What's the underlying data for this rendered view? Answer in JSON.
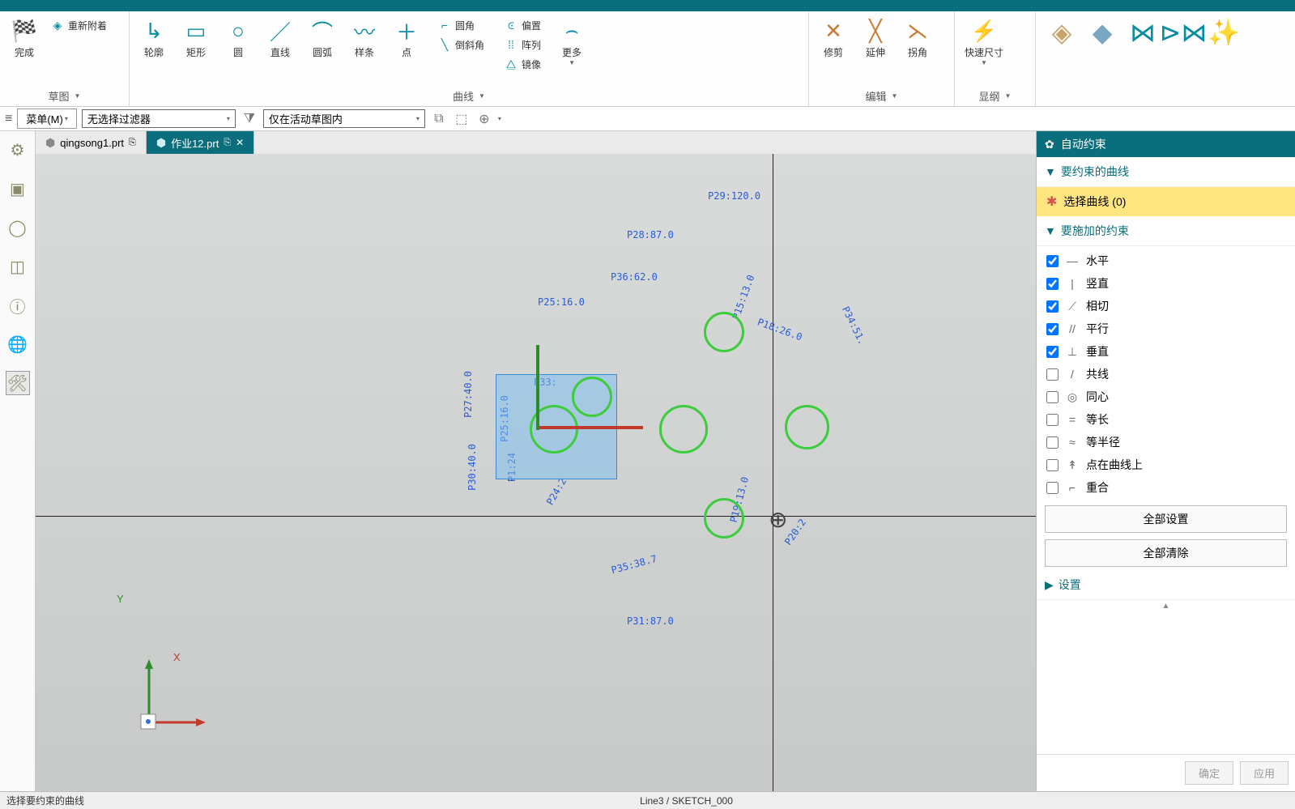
{
  "ribbon": {
    "groups": {
      "sketch": {
        "label": "草图",
        "finish": "完成",
        "reattach": "重新附着"
      },
      "curve": {
        "label": "曲线",
        "profile": "轮廓",
        "rect": "矩形",
        "circle": "圆",
        "line": "直线",
        "arc": "圆弧",
        "spline": "样条",
        "point": "点",
        "fillet": "圆角",
        "chamfer": "倒斜角",
        "offset": "偏置",
        "pattern": "阵列",
        "mirror": "镜像",
        "more": "更多"
      },
      "edit": {
        "label": "编辑",
        "trim": "修剪",
        "extend": "延伸",
        "corner": "拐角"
      },
      "dimension": {
        "label": "显纲",
        "rapid": "快速尺寸"
      }
    }
  },
  "sub_toolbar": {
    "menu": "菜单(M)",
    "filter": "无选择过滤器",
    "scope": "仅在活动草图内"
  },
  "tabs": [
    {
      "name": "qingsong1.prt",
      "active": false
    },
    {
      "name": "作业12.prt",
      "active": true
    }
  ],
  "right_panel": {
    "title": "自动约束",
    "sec_curves": "要约束的曲线",
    "select_curve": "选择曲线 (0)",
    "sec_constraints": "要施加的约束",
    "constraints": [
      {
        "label": "水平",
        "icon": "—",
        "checked": true
      },
      {
        "label": "竖直",
        "icon": "|",
        "checked": true
      },
      {
        "label": "相切",
        "icon": "⟋",
        "checked": true
      },
      {
        "label": "平行",
        "icon": "//",
        "checked": true
      },
      {
        "label": "垂直",
        "icon": "⊥",
        "checked": true
      },
      {
        "label": "共线",
        "icon": "/",
        "checked": false
      },
      {
        "label": "同心",
        "icon": "◎",
        "checked": false
      },
      {
        "label": "等长",
        "icon": "=",
        "checked": false
      },
      {
        "label": "等半径",
        "icon": "≈",
        "checked": false
      },
      {
        "label": "点在曲线上",
        "icon": "↟",
        "checked": false
      },
      {
        "label": "重合",
        "icon": "⌐",
        "checked": false
      }
    ],
    "set_all": "全部设置",
    "clear_all": "全部清除",
    "settings": "设置",
    "ok": "确定",
    "apply": "应用"
  },
  "status": {
    "left": "选择要约束的曲线",
    "center": "Line3 / SKETCH_000"
  },
  "canvas_dims": {
    "p29": "P29:120.0",
    "p28": "P28:87.0",
    "p36": "P36:62.0",
    "p25_16": "P25:16.0",
    "p18": "P18:26.0",
    "p34": "P34:51.",
    "p15": "P15:13.0",
    "p27": "P27:40.0",
    "p25v": "P25:16.0",
    "p30": "P30:40.0",
    "p33": "P33:",
    "p24": "P24:2",
    "p19": "P19:13.0",
    "p20": "P20:2",
    "p35": "P35:38.7",
    "p31": "P31:87.0",
    "p1324": "P1:24"
  },
  "axes": {
    "x": "X",
    "y": "Y"
  }
}
